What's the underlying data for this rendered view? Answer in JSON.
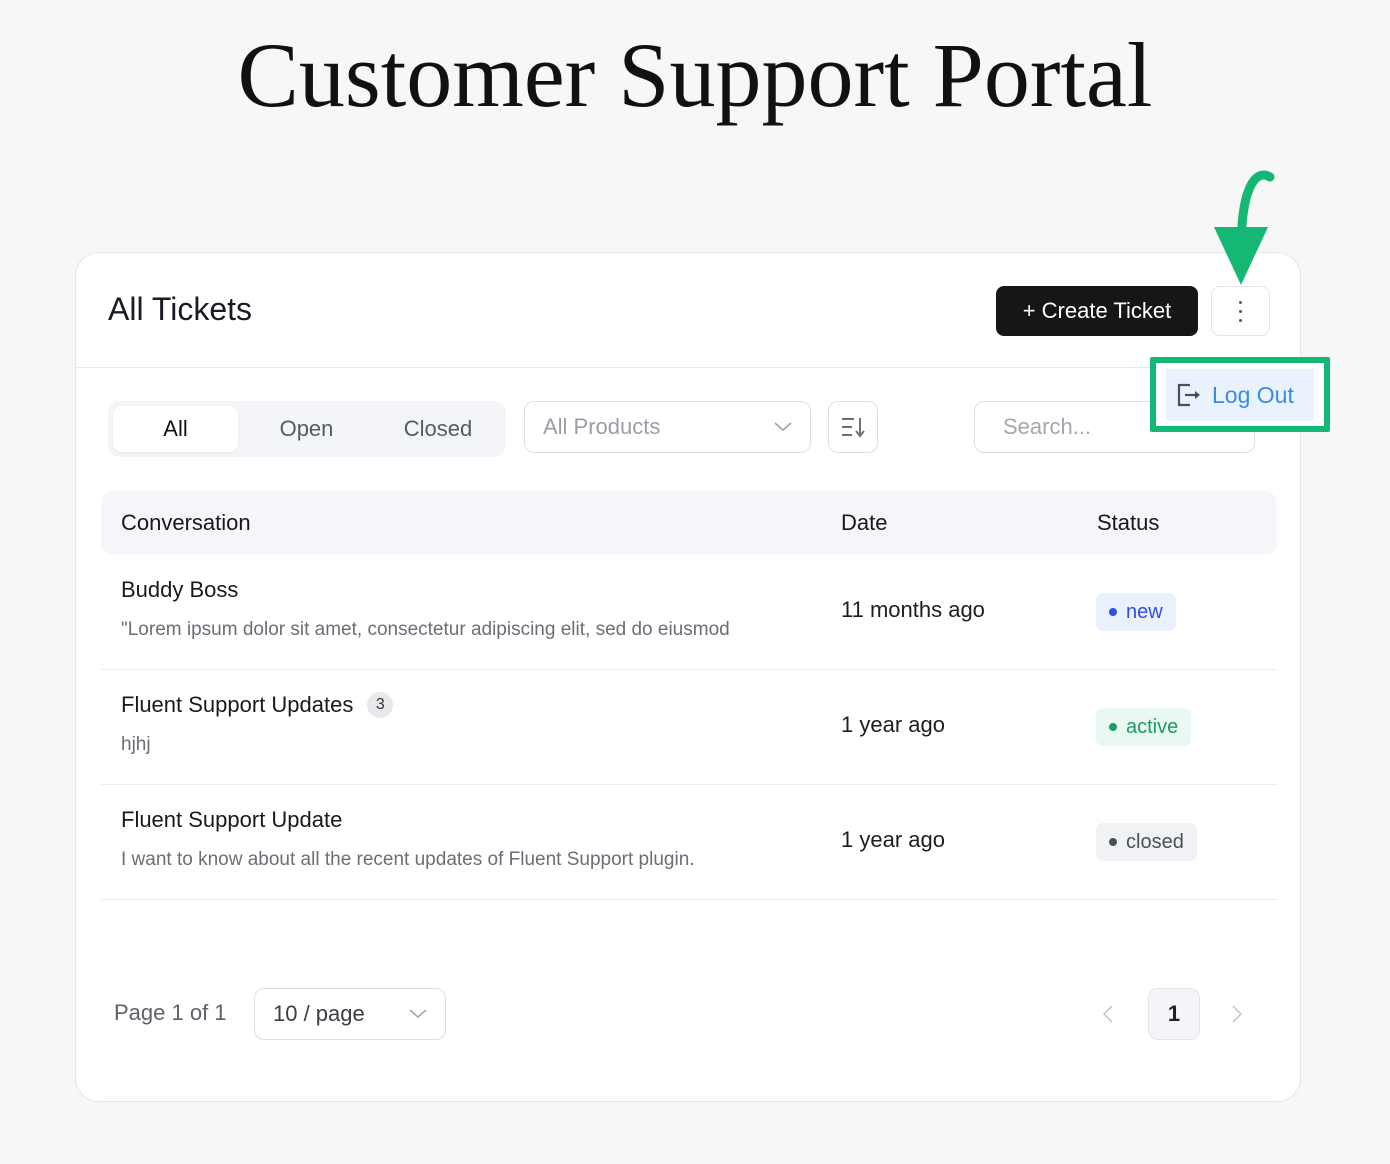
{
  "page": {
    "title": "Customer Support Portal"
  },
  "card": {
    "title": "All Tickets",
    "create_button_label": "+ Create Ticket",
    "more_menu": {
      "items": [
        {
          "label": "Log Out",
          "icon": "logout-icon"
        }
      ]
    }
  },
  "annotation": {
    "arrow_color": "#14b874",
    "highlight_color": "#14b874"
  },
  "filters": {
    "tabs": [
      {
        "label": "All",
        "active": true
      },
      {
        "label": "Open",
        "active": false
      },
      {
        "label": "Closed",
        "active": false
      }
    ],
    "product_select": {
      "value": "All Products",
      "icon": "chevron-down-icon"
    },
    "sort_icon": "sort-descending-icon",
    "search": {
      "placeholder": "Search...",
      "value": ""
    }
  },
  "table": {
    "columns": [
      "Conversation",
      "Date",
      "Status"
    ],
    "rows": [
      {
        "title": "Buddy Boss",
        "count": null,
        "preview": "\"Lorem ipsum dolor sit amet, consectetur adipiscing elit, sed do eiusmod",
        "date": "11 months ago",
        "status": "new",
        "status_color": "#2f4fe0",
        "status_bg": "#ebf0fd"
      },
      {
        "title": "Fluent Support Updates",
        "count": "3",
        "preview": "hjhj",
        "date": "1 year ago",
        "status": "active",
        "status_color": "#1f9a6b",
        "status_bg": "#e9f8f1"
      },
      {
        "title": "Fluent Support Update",
        "count": null,
        "preview": "I want to know about all the recent updates of Fluent Support plugin.",
        "date": "1 year ago",
        "status": "closed",
        "status_color": "#4a4e56",
        "status_bg": "#f1f2f5"
      }
    ]
  },
  "pagination": {
    "page_info": "Page 1 of 1",
    "per_page": "10 / page",
    "current_page": "1"
  }
}
